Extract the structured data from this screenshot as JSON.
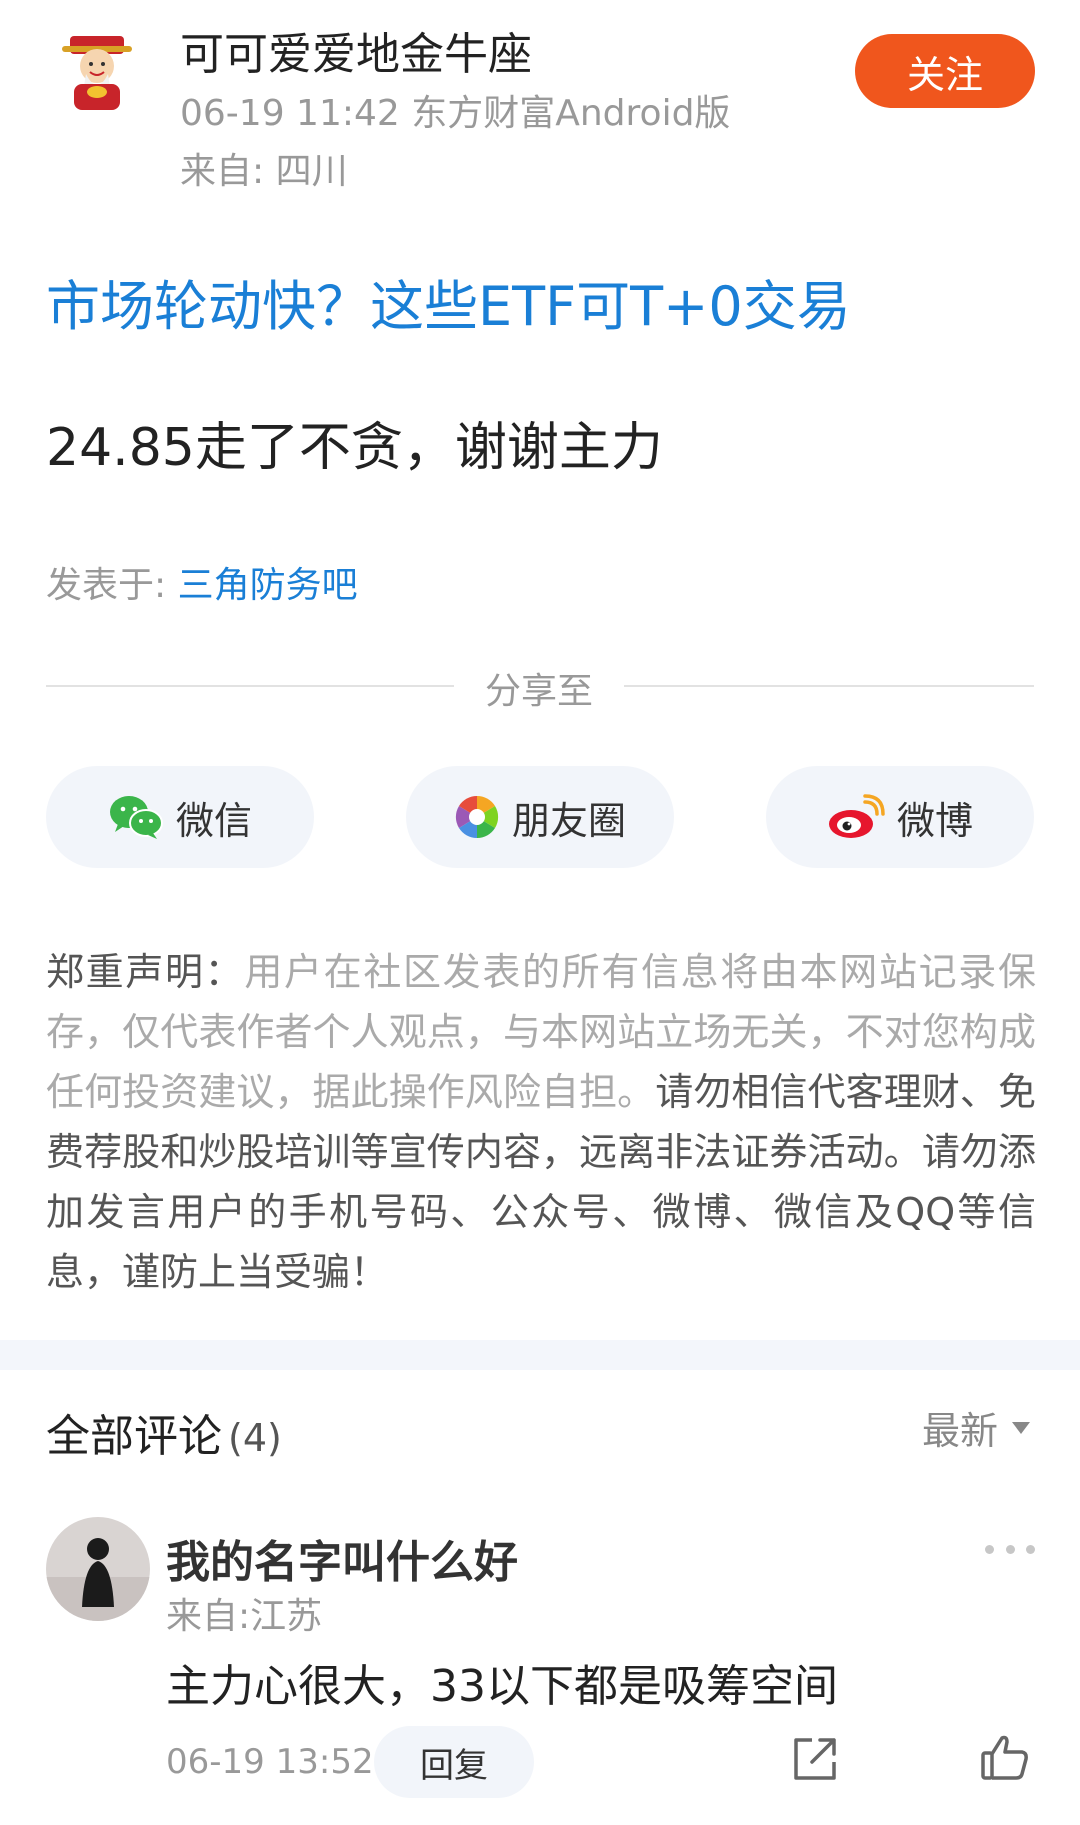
{
  "author": {
    "name": "可可爱爱地金牛座",
    "meta": "06-19 11:42 东方财富Android版",
    "location": "来自: 四川",
    "follow_label": "关注",
    "avatar_icon": "god-of-wealth-avatar"
  },
  "post": {
    "headline": "市场轮动快？这些ETF可T+0交易",
    "body": "24.85走了不贪，谢谢主力",
    "posted_in_label": "发表于: ",
    "posted_in_forum": "三角防务吧"
  },
  "share": {
    "title": "分享至",
    "buttons": [
      {
        "label": "微信",
        "icon": "wechat-icon"
      },
      {
        "label": "朋友圈",
        "icon": "moments-icon"
      },
      {
        "label": "微博",
        "icon": "weibo-icon"
      }
    ]
  },
  "disclaimer": {
    "lead": "郑重声明：",
    "gray_text": "用户在社区发表的所有信息将由本网站记录保存，仅代表作者个人观点，与本网站立场无关，不对您构成任何投资建议，据此操作风险自担。",
    "dark_text": "请勿相信代客理财、免费荐股和炒股培训等宣传内容，远离非法证券活动。请勿添加发言用户的手机号码、公众号、微博、微信及QQ等信息，谨防上当受骗！"
  },
  "comments": {
    "title": "全部评论",
    "count": "(4)",
    "sort_label": "最新",
    "items": [
      {
        "user": "我的名字叫什么好",
        "location": "来自:江苏",
        "text": "主力心很大，33以下都是吸筹空间",
        "time": "06-19 13:52",
        "reply_label": "回复"
      }
    ]
  },
  "colors": {
    "accent_orange": "#f0561d",
    "link_blue": "#1a7fd6",
    "muted_gray": "#999999"
  }
}
